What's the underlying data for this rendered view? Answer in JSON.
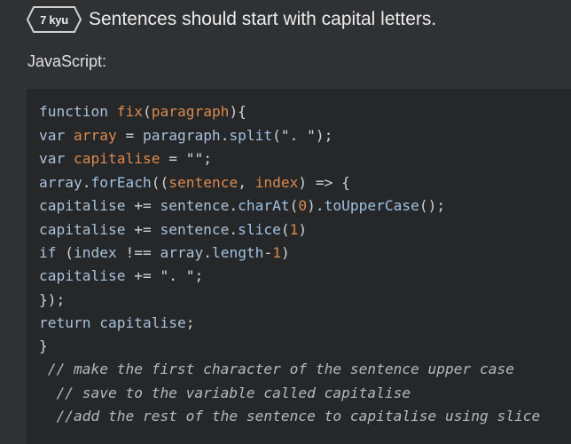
{
  "kata": {
    "rank_label": "7 kyu",
    "title": "Sentences should start with capital letters."
  },
  "language": "JavaScript:",
  "code": {
    "l1": {
      "a": "function ",
      "b": "fix",
      "c": "(",
      "d": "paragraph",
      "e": "){"
    },
    "l2": {
      "a": "var ",
      "b": "array",
      "c": " = ",
      "d": "paragraph",
      "e": ".",
      "f": "split",
      "g": "(",
      "h": "\". \"",
      "i": ");"
    },
    "l3": {
      "a": "var ",
      "b": "capitalise",
      "c": " = ",
      "d": "\"\"",
      "e": ";"
    },
    "l4": {
      "a": "array",
      "b": ".",
      "c": "forEach",
      "d": "((",
      "e": "sentence",
      "f": ", ",
      "g": "index",
      "h": ") => {"
    },
    "l5": {
      "a": "capitalise",
      "b": " += ",
      "c": "sentence",
      "d": ".",
      "e": "charAt",
      "f": "(",
      "g": "0",
      "h": ").",
      "i": "toUpperCase",
      "j": "();"
    },
    "l6": {
      "a": "capitalise",
      "b": " += ",
      "c": "sentence",
      "d": ".",
      "e": "slice",
      "f": "(",
      "g": "1",
      "h": ")"
    },
    "l7": {
      "a": "if ",
      "b": "(",
      "c": "index",
      "d": " !== ",
      "e": "array",
      "f": ".",
      "g": "length",
      "h": "-",
      "i": "1",
      "j": ")"
    },
    "l8": {
      "a": "capitalise",
      "b": " += ",
      "c": "\". \"",
      "d": ";"
    },
    "l9": {
      "a": "});"
    },
    "l10": {
      "a": "return ",
      "b": "capitalise",
      "c": ";"
    },
    "l11": {
      "a": "}"
    },
    "c1": " // make the first character of the sentence upper case",
    "c2": "  // save to the variable called capitalise",
    "c3": "  //add the rest of the sentence to capitalise using slice"
  },
  "colors": {
    "background": "#303133",
    "code_background": "#262729",
    "keyword": "#a9c1da",
    "identifier": "#d98a4f",
    "comment": "#b8b8b8"
  }
}
